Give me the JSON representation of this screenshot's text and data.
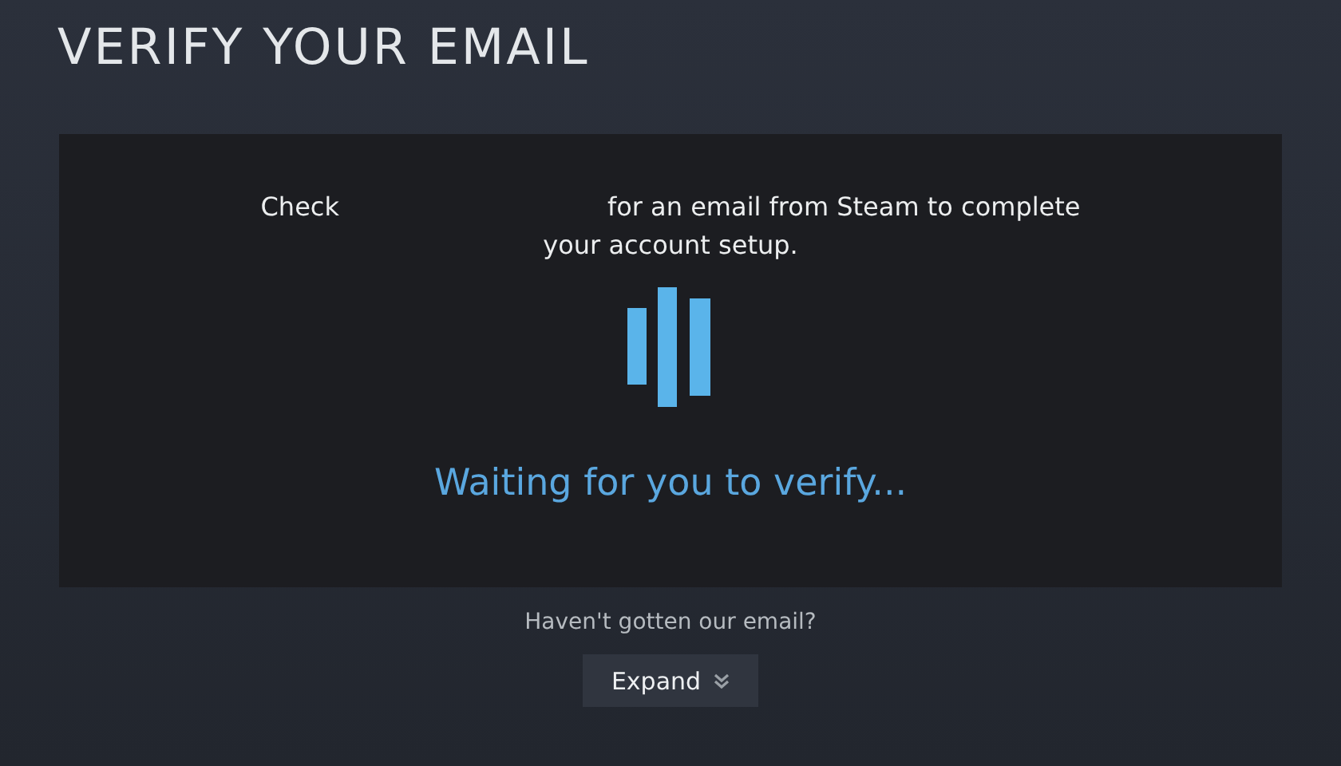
{
  "title": "VERIFY YOUR EMAIL",
  "message": {
    "lead": "Check",
    "rest": "for an email from Steam to complete your account setup."
  },
  "status": "Waiting for you to verify...",
  "help_text": "Haven't gotten our email?",
  "expand_button": {
    "label": "Expand",
    "expanded": false
  }
}
